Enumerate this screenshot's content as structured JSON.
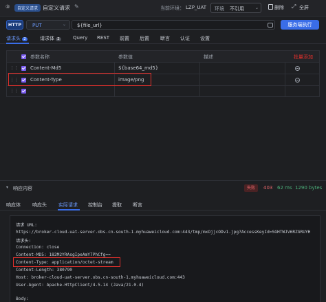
{
  "header": {
    "step_badge": "③",
    "tag": "自定义请求",
    "title": "自定义请求",
    "edit_icon": "pencil-icon",
    "env_label": "当前环境：",
    "env_value": "LZP_UAT",
    "env_select_label": "环境",
    "env_select_value": "不引用",
    "delete_label": "删除",
    "fullscreen_label": "全屏"
  },
  "request": {
    "protocol": "HTTP",
    "method": "PUT",
    "url": "${file_url}",
    "execute_label": "服务端执行"
  },
  "request_tabs": {
    "headers_label": "请求头",
    "headers_count": "2",
    "body_label": "请求体",
    "body_count": "2",
    "tabs": [
      "Query",
      "REST",
      "前置",
      "后置",
      "断言",
      "认证",
      "设置"
    ]
  },
  "headers_table": {
    "columns": {
      "name": "参数名称",
      "value": "参数值",
      "desc": "描述",
      "action": "批量添加"
    },
    "rows": [
      {
        "name": "Content-Md5",
        "value": "${base64_md5}",
        "desc": ""
      },
      {
        "name": "Content-Type",
        "value": "image/png",
        "desc": ""
      }
    ]
  },
  "response": {
    "title": "响应内容",
    "status": "失败",
    "code": "403",
    "time": "62 ms",
    "size": "1290 bytes",
    "tabs": [
      "响应体",
      "响应头",
      "实际请求",
      "控制台",
      "提取",
      "断言"
    ],
    "active_tab": "实际请求",
    "lines": [
      "请求 URL:",
      "https://broker-cloud-uat-server.obs.cn-south-1.myhuaweicloud.com:443/tmp/mxOjjcODv1.jpg?AccessKeyId=SGHTWJV6RZGRUYH",
      "请求头:",
      "Connection: close",
      "Content-MD5: 182M2YRAsgIpeAmY7PhCfg==",
      "Content-Type: application/octet-stream",
      "Content-Length: 380790",
      "Host: broker-cloud-uat-server.obs.cn-south-1.myhuaweicloud.com:443",
      "User-Agent: Apache-HttpClient/4.5.14 (Java/21.0.4)",
      "",
      "Body:"
    ]
  },
  "colors": {
    "accent": "#3a6de8",
    "checkbox": "#7a5cf0",
    "highlight_box": "#e0302c",
    "error": "#e4666a",
    "success": "#4caf7a"
  }
}
